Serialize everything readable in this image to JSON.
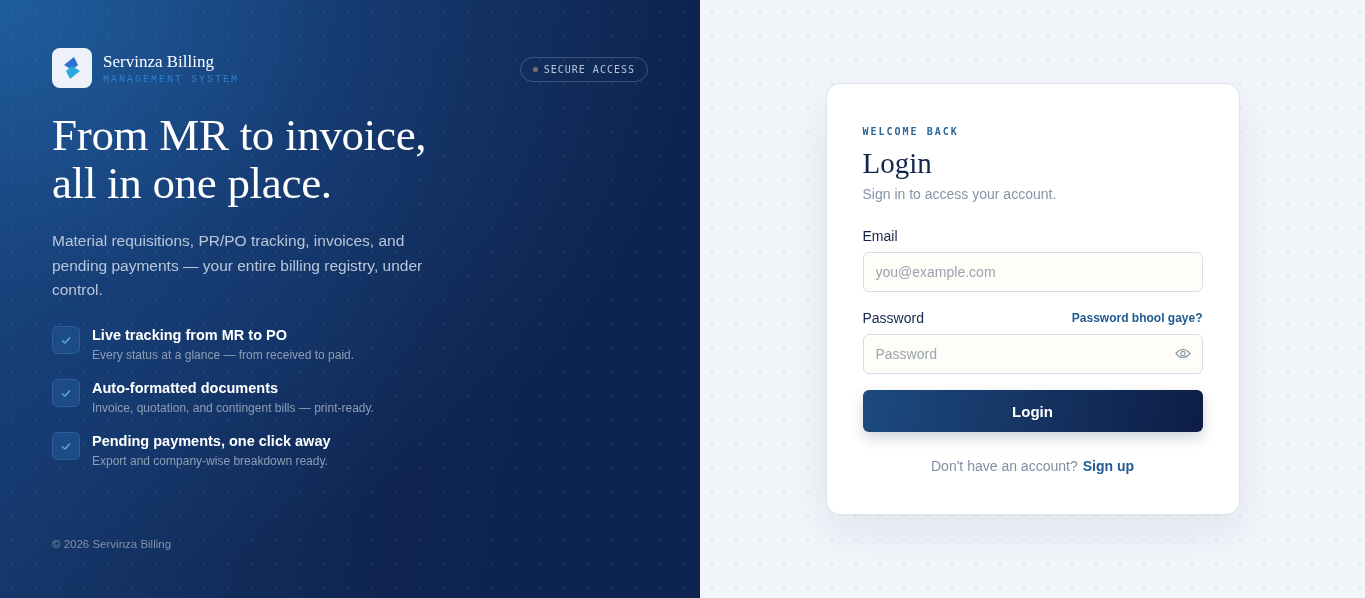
{
  "brand": {
    "name": "Servinza Billing",
    "subtitle": "MANAGEMENT SYSTEM"
  },
  "badge": "SECURE ACCESS",
  "headline": "From MR to invoice,\nall in one place.",
  "description": "Material requisitions, PR/PO tracking, invoices, and pending payments — your entire billing registry, under control.",
  "features": [
    {
      "title": "Live tracking from MR to PO",
      "text": "Every status at a glance — from received to paid."
    },
    {
      "title": "Auto-formatted documents",
      "text": "Invoice, quotation, and contingent bills — print-ready."
    },
    {
      "title": "Pending payments, one click away",
      "text": "Export and company-wise breakdown ready."
    }
  ],
  "footer": "© 2026 Servinza Billing",
  "form": {
    "eyebrow": "WELCOME BACK",
    "title": "Login",
    "subtitle": "Sign in to access your account.",
    "fields": [
      {
        "kind": "email",
        "label": "Email",
        "placeholder": "you@example.com"
      },
      {
        "kind": "password",
        "label": "Password",
        "placeholder": "Password",
        "link": "Password bhool gaye?"
      }
    ],
    "button": "Login",
    "signup_prompt": "Don't have an account?",
    "signup_link": "Sign up"
  }
}
